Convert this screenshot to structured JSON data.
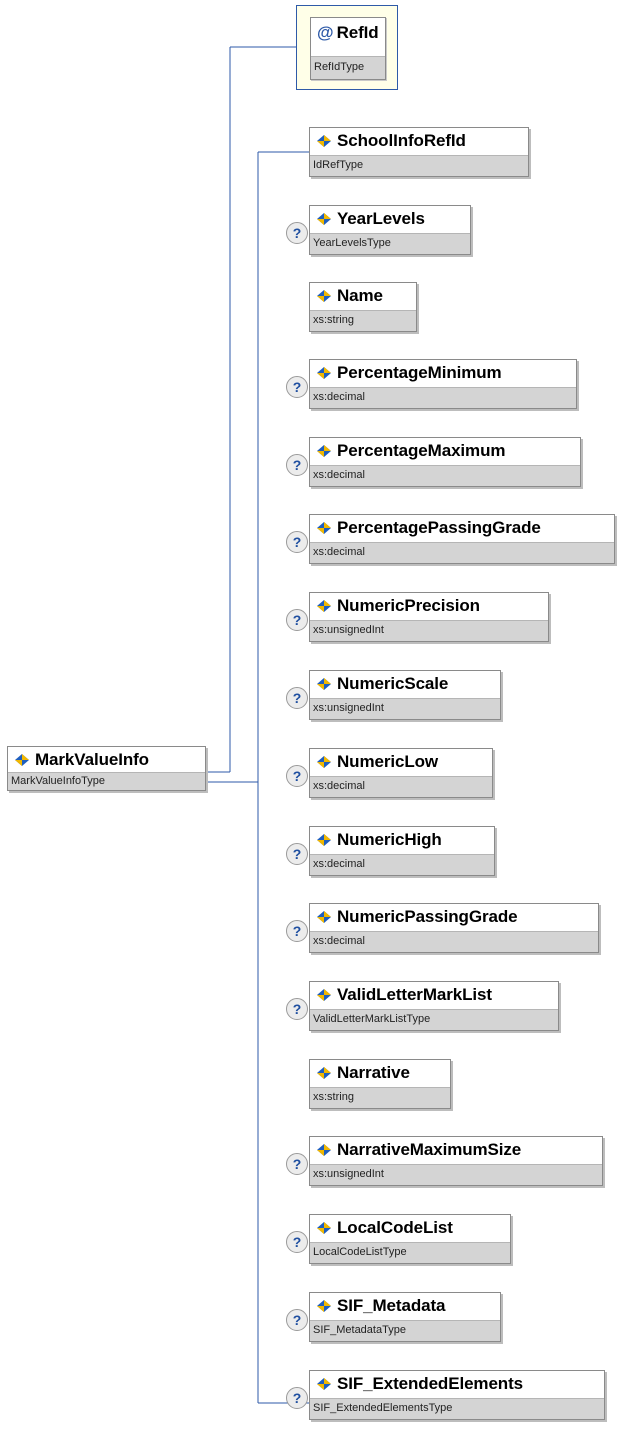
{
  "root": {
    "name": "MarkValueInfo",
    "type": "MarkValueInfoType"
  },
  "attribute": {
    "symbol": "@",
    "name": "RefId",
    "type": "RefIdType"
  },
  "optional_symbol": "?",
  "elements": [
    {
      "name": "SchoolInfoRefId",
      "type": "IdRefType",
      "optional": false
    },
    {
      "name": "YearLevels",
      "type": "YearLevelsType",
      "optional": true
    },
    {
      "name": "Name",
      "type": "xs:string",
      "optional": false
    },
    {
      "name": "PercentageMinimum",
      "type": "xs:decimal",
      "optional": true
    },
    {
      "name": "PercentageMaximum",
      "type": "xs:decimal",
      "optional": true
    },
    {
      "name": "PercentagePassingGrade",
      "type": "xs:decimal",
      "optional": true
    },
    {
      "name": "NumericPrecision",
      "type": "xs:unsignedInt",
      "optional": true
    },
    {
      "name": "NumericScale",
      "type": "xs:unsignedInt",
      "optional": true
    },
    {
      "name": "NumericLow",
      "type": "xs:decimal",
      "optional": true
    },
    {
      "name": "NumericHigh",
      "type": "xs:decimal",
      "optional": true
    },
    {
      "name": "NumericPassingGrade",
      "type": "xs:decimal",
      "optional": true
    },
    {
      "name": "ValidLetterMarkList",
      "type": "ValidLetterMarkListType",
      "optional": true
    },
    {
      "name": "Narrative",
      "type": "xs:string",
      "optional": false
    },
    {
      "name": "NarrativeMaximumSize",
      "type": "xs:unsignedInt",
      "optional": true
    },
    {
      "name": "LocalCodeList",
      "type": "LocalCodeListType",
      "optional": true
    },
    {
      "name": "SIF_Metadata",
      "type": "SIF_MetadataType",
      "optional": true
    },
    {
      "name": "SIF_ExtendedElements",
      "type": "SIF_ExtendedElementsType",
      "optional": true
    }
  ]
}
